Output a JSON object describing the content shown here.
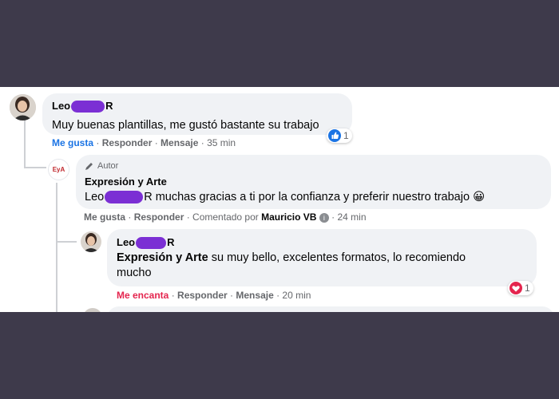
{
  "comment1": {
    "author_first": "Leo",
    "author_last": "R",
    "text": "Muy buenas plantillas, me gustó bastante su trabajo",
    "actions": {
      "like": "Me gusta",
      "reply": "Responder",
      "message": "Mensaje",
      "time": "35 min"
    },
    "reaction_count": "1"
  },
  "reply1": {
    "badge": "Autor",
    "author": "Expresión y Arte",
    "mention_first": "Leo",
    "mention_last": "R",
    "text": "muchas gracias a ti por la confianza y preferir nuestro trabajo",
    "emoji": "😀",
    "actions": {
      "like": "Me gusta",
      "reply": "Responder",
      "commented_by": "Comentado por",
      "commenter": "Mauricio VB",
      "time": "24 min"
    }
  },
  "reply2": {
    "author_first": "Leo",
    "author_last": "R",
    "mention": "Expresión y Arte",
    "text_line1": "su muy bello, excelentes formatos, lo recomiendo",
    "text_line2": "mucho",
    "actions": {
      "love": "Me encanta",
      "reply": "Responder",
      "message": "Mensaje",
      "time": "20 min"
    },
    "reaction_count": "1"
  },
  "colors": {
    "like_blue": "#1b74e4",
    "love_red": "#e4254e",
    "redaction": "#7b2fd4",
    "background": "#3e3a4b",
    "bubble": "#f0f2f5"
  },
  "icons": [
    "avatar",
    "pencil-icon",
    "like-reaction-icon",
    "love-reaction-icon",
    "info-icon",
    "grinning-emoji"
  ]
}
